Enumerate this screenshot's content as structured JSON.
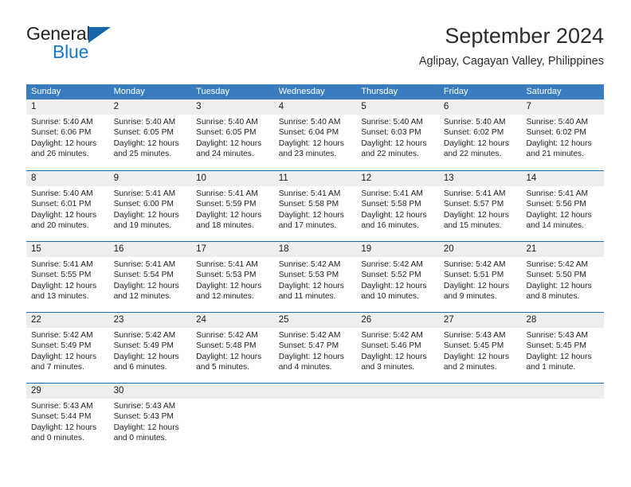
{
  "brand": {
    "name_part1": "General",
    "name_part2": "Blue",
    "triangle_color": "#1565a8",
    "blue_color": "#1878cf"
  },
  "header": {
    "title": "September 2024",
    "subtitle": "Aglipay, Cagayan Valley, Philippines"
  },
  "theme": {
    "header_blue": "#3a7dbf",
    "row_divider_blue": "#1f6ab0",
    "day_band_gray": "#eeeeee"
  },
  "weekdays": [
    "Sunday",
    "Monday",
    "Tuesday",
    "Wednesday",
    "Thursday",
    "Friday",
    "Saturday"
  ],
  "weeks": [
    [
      {
        "day": "1",
        "sunrise": "Sunrise: 5:40 AM",
        "sunset": "Sunset: 6:06 PM",
        "daylight": "Daylight: 12 hours and 26 minutes."
      },
      {
        "day": "2",
        "sunrise": "Sunrise: 5:40 AM",
        "sunset": "Sunset: 6:05 PM",
        "daylight": "Daylight: 12 hours and 25 minutes."
      },
      {
        "day": "3",
        "sunrise": "Sunrise: 5:40 AM",
        "sunset": "Sunset: 6:05 PM",
        "daylight": "Daylight: 12 hours and 24 minutes."
      },
      {
        "day": "4",
        "sunrise": "Sunrise: 5:40 AM",
        "sunset": "Sunset: 6:04 PM",
        "daylight": "Daylight: 12 hours and 23 minutes."
      },
      {
        "day": "5",
        "sunrise": "Sunrise: 5:40 AM",
        "sunset": "Sunset: 6:03 PM",
        "daylight": "Daylight: 12 hours and 22 minutes."
      },
      {
        "day": "6",
        "sunrise": "Sunrise: 5:40 AM",
        "sunset": "Sunset: 6:02 PM",
        "daylight": "Daylight: 12 hours and 22 minutes."
      },
      {
        "day": "7",
        "sunrise": "Sunrise: 5:40 AM",
        "sunset": "Sunset: 6:02 PM",
        "daylight": "Daylight: 12 hours and 21 minutes."
      }
    ],
    [
      {
        "day": "8",
        "sunrise": "Sunrise: 5:40 AM",
        "sunset": "Sunset: 6:01 PM",
        "daylight": "Daylight: 12 hours and 20 minutes."
      },
      {
        "day": "9",
        "sunrise": "Sunrise: 5:41 AM",
        "sunset": "Sunset: 6:00 PM",
        "daylight": "Daylight: 12 hours and 19 minutes."
      },
      {
        "day": "10",
        "sunrise": "Sunrise: 5:41 AM",
        "sunset": "Sunset: 5:59 PM",
        "daylight": "Daylight: 12 hours and 18 minutes."
      },
      {
        "day": "11",
        "sunrise": "Sunrise: 5:41 AM",
        "sunset": "Sunset: 5:58 PM",
        "daylight": "Daylight: 12 hours and 17 minutes."
      },
      {
        "day": "12",
        "sunrise": "Sunrise: 5:41 AM",
        "sunset": "Sunset: 5:58 PM",
        "daylight": "Daylight: 12 hours and 16 minutes."
      },
      {
        "day": "13",
        "sunrise": "Sunrise: 5:41 AM",
        "sunset": "Sunset: 5:57 PM",
        "daylight": "Daylight: 12 hours and 15 minutes."
      },
      {
        "day": "14",
        "sunrise": "Sunrise: 5:41 AM",
        "sunset": "Sunset: 5:56 PM",
        "daylight": "Daylight: 12 hours and 14 minutes."
      }
    ],
    [
      {
        "day": "15",
        "sunrise": "Sunrise: 5:41 AM",
        "sunset": "Sunset: 5:55 PM",
        "daylight": "Daylight: 12 hours and 13 minutes."
      },
      {
        "day": "16",
        "sunrise": "Sunrise: 5:41 AM",
        "sunset": "Sunset: 5:54 PM",
        "daylight": "Daylight: 12 hours and 12 minutes."
      },
      {
        "day": "17",
        "sunrise": "Sunrise: 5:41 AM",
        "sunset": "Sunset: 5:53 PM",
        "daylight": "Daylight: 12 hours and 12 minutes."
      },
      {
        "day": "18",
        "sunrise": "Sunrise: 5:42 AM",
        "sunset": "Sunset: 5:53 PM",
        "daylight": "Daylight: 12 hours and 11 minutes."
      },
      {
        "day": "19",
        "sunrise": "Sunrise: 5:42 AM",
        "sunset": "Sunset: 5:52 PM",
        "daylight": "Daylight: 12 hours and 10 minutes."
      },
      {
        "day": "20",
        "sunrise": "Sunrise: 5:42 AM",
        "sunset": "Sunset: 5:51 PM",
        "daylight": "Daylight: 12 hours and 9 minutes."
      },
      {
        "day": "21",
        "sunrise": "Sunrise: 5:42 AM",
        "sunset": "Sunset: 5:50 PM",
        "daylight": "Daylight: 12 hours and 8 minutes."
      }
    ],
    [
      {
        "day": "22",
        "sunrise": "Sunrise: 5:42 AM",
        "sunset": "Sunset: 5:49 PM",
        "daylight": "Daylight: 12 hours and 7 minutes."
      },
      {
        "day": "23",
        "sunrise": "Sunrise: 5:42 AM",
        "sunset": "Sunset: 5:49 PM",
        "daylight": "Daylight: 12 hours and 6 minutes."
      },
      {
        "day": "24",
        "sunrise": "Sunrise: 5:42 AM",
        "sunset": "Sunset: 5:48 PM",
        "daylight": "Daylight: 12 hours and 5 minutes."
      },
      {
        "day": "25",
        "sunrise": "Sunrise: 5:42 AM",
        "sunset": "Sunset: 5:47 PM",
        "daylight": "Daylight: 12 hours and 4 minutes."
      },
      {
        "day": "26",
        "sunrise": "Sunrise: 5:42 AM",
        "sunset": "Sunset: 5:46 PM",
        "daylight": "Daylight: 12 hours and 3 minutes."
      },
      {
        "day": "27",
        "sunrise": "Sunrise: 5:43 AM",
        "sunset": "Sunset: 5:45 PM",
        "daylight": "Daylight: 12 hours and 2 minutes."
      },
      {
        "day": "28",
        "sunrise": "Sunrise: 5:43 AM",
        "sunset": "Sunset: 5:45 PM",
        "daylight": "Daylight: 12 hours and 1 minute."
      }
    ],
    [
      {
        "day": "29",
        "sunrise": "Sunrise: 5:43 AM",
        "sunset": "Sunset: 5:44 PM",
        "daylight": "Daylight: 12 hours and 0 minutes."
      },
      {
        "day": "30",
        "sunrise": "Sunrise: 5:43 AM",
        "sunset": "Sunset: 5:43 PM",
        "daylight": "Daylight: 12 hours and 0 minutes."
      },
      {
        "day": "",
        "sunrise": "",
        "sunset": "",
        "daylight": ""
      },
      {
        "day": "",
        "sunrise": "",
        "sunset": "",
        "daylight": ""
      },
      {
        "day": "",
        "sunrise": "",
        "sunset": "",
        "daylight": ""
      },
      {
        "day": "",
        "sunrise": "",
        "sunset": "",
        "daylight": ""
      },
      {
        "day": "",
        "sunrise": "",
        "sunset": "",
        "daylight": ""
      }
    ]
  ]
}
